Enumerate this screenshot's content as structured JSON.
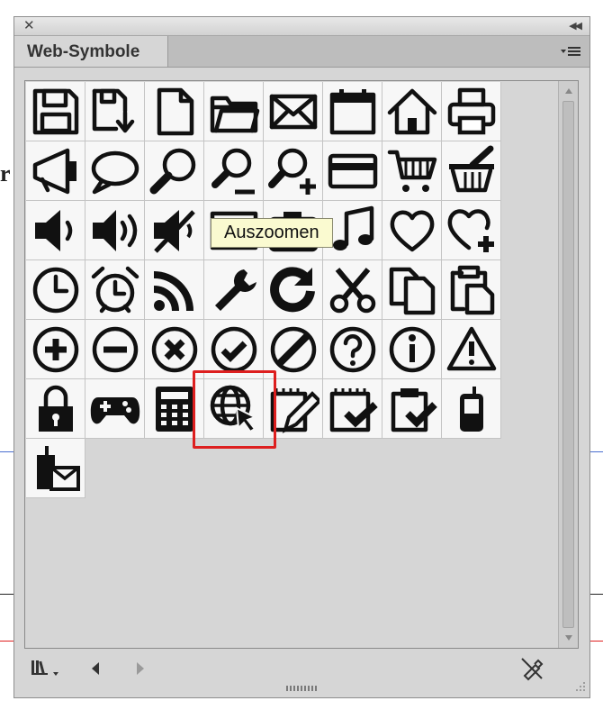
{
  "panel": {
    "title": "Web-Symbole",
    "tooltip": "Auszoomen",
    "selected_symbol": "globe-cursor"
  },
  "colors": {
    "selection": "#dd1f1f",
    "tooltip_bg": "#fafad0",
    "panel_bg": "#d6d6d6",
    "cell_bg": "#f7f7f7"
  },
  "symbols": [
    "floppy-disk",
    "save-download",
    "document",
    "folder",
    "envelope",
    "calendar",
    "house",
    "printer",
    "megaphone",
    "speech-bubble",
    "magnifier",
    "zoom-out",
    "zoom-in",
    "credit-card",
    "shopping-cart",
    "shopping-basket",
    "speaker-low",
    "speaker-high",
    "speaker-mute",
    "image",
    "camera",
    "music-note",
    "heart",
    "heart-plus",
    "clock",
    "alarm-clock",
    "rss-feed",
    "wrench",
    "refresh",
    "scissors",
    "copy",
    "paste",
    "plus-circle",
    "minus-circle",
    "x-circle",
    "check-circle",
    "no-entry-circle",
    "question-circle",
    "info-circle",
    "warning-triangle",
    "padlock",
    "gamepad",
    "calculator",
    "globe-cursor",
    "notepad-pencil",
    "notepad-check",
    "clipboard-check",
    "mobile-phone",
    "mobile-mail"
  ],
  "bottom_icons": [
    "library-menu-icon",
    "prev-arrow-icon",
    "next-arrow-icon",
    "break-link-icon"
  ]
}
